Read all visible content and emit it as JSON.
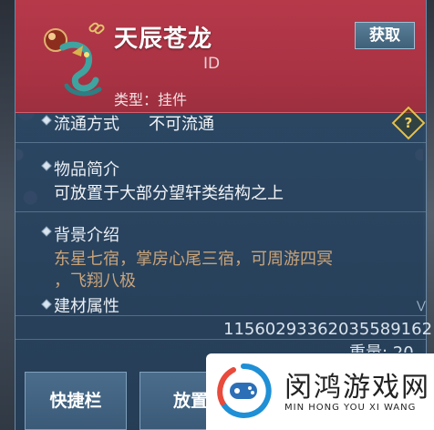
{
  "item": {
    "name": "天辰苍龙",
    "id_label": "ID",
    "type_label": "类型：挂件",
    "obtain_button": "获取"
  },
  "sections": {
    "circulation_label": "流通方式",
    "circulation_value": "不可流通",
    "summary_label": "物品简介",
    "summary_text": "可放置于大部分望轩类结构之上",
    "background_label": "背景介绍",
    "background_line1": "东星七宿，掌房心尾三宿，可周游四冥",
    "background_line2": "，飞翔八极",
    "attributes_label": "建材属性"
  },
  "footer": {
    "serial": "11560293362035589162",
    "weight": "重量: 20"
  },
  "actions": {
    "shortcut": "快捷栏",
    "place": "放置"
  },
  "hud": {
    "alert": "!"
  },
  "watermark": {
    "title": "闵鸿游戏网",
    "subtitle": "MIN HONG YOU XI WANG"
  },
  "icons": {
    "item": "dragon-pendant-icon",
    "link": "link-icon",
    "help": "help-icon",
    "scroll": "chevron-down-icon"
  },
  "colors": {
    "header": "#b6394a",
    "panel": "#2c4a68",
    "lore_text": "#c9a47a",
    "help_accent": "#e5c14b"
  }
}
